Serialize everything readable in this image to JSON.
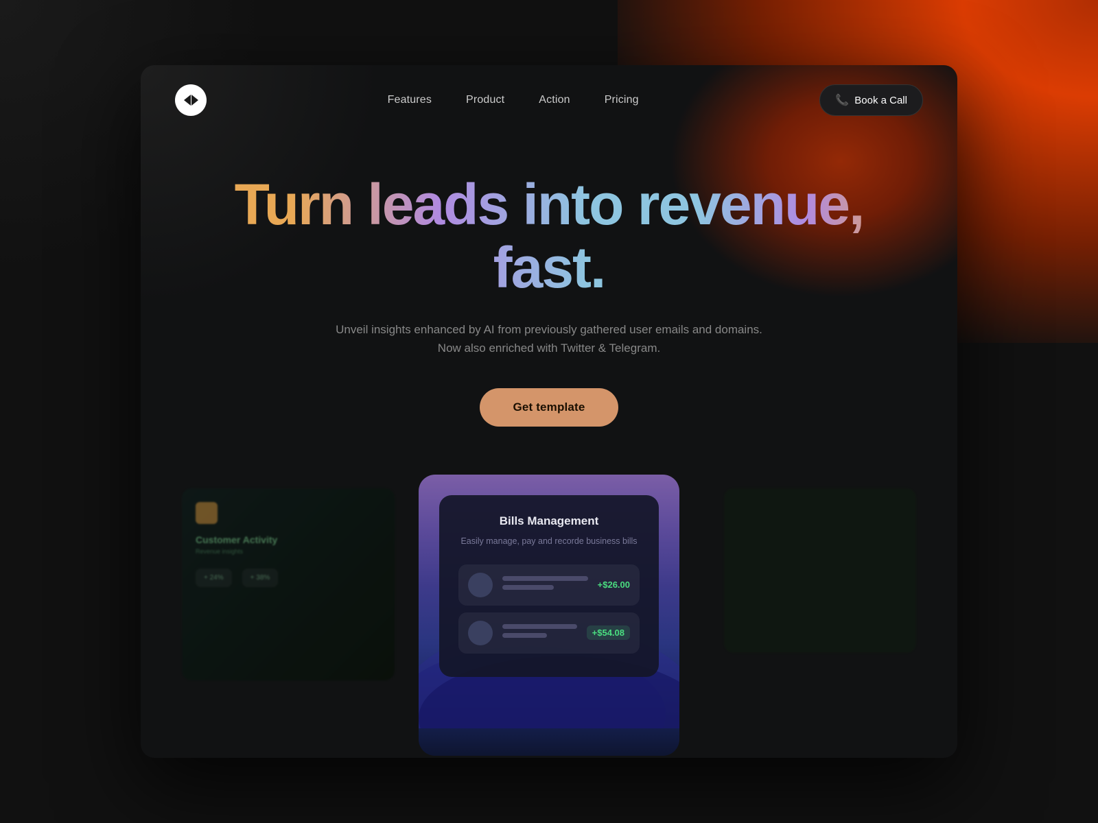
{
  "page": {
    "background": "#111"
  },
  "navbar": {
    "logo_alt": "Logo",
    "links": [
      {
        "label": "Features",
        "id": "features"
      },
      {
        "label": "Product",
        "id": "product"
      },
      {
        "label": "Action",
        "id": "action"
      },
      {
        "label": "Pricing",
        "id": "pricing"
      }
    ],
    "cta_label": "Book a Call"
  },
  "hero": {
    "title": "Turn leads into revenue, fast.",
    "subtitle_line1": "Unveil insights enhanced by AI from previously gathered user emails and domains.",
    "subtitle_line2": "Now also enriched with Twitter & Telegram.",
    "cta_label": "Get template"
  },
  "bills_card": {
    "title": "Bills Management",
    "subtitle": "Easily manage, pay and recorde business bills",
    "row1": {
      "amount": "+$26.00"
    },
    "row2": {
      "amount": "+$54.08"
    }
  }
}
